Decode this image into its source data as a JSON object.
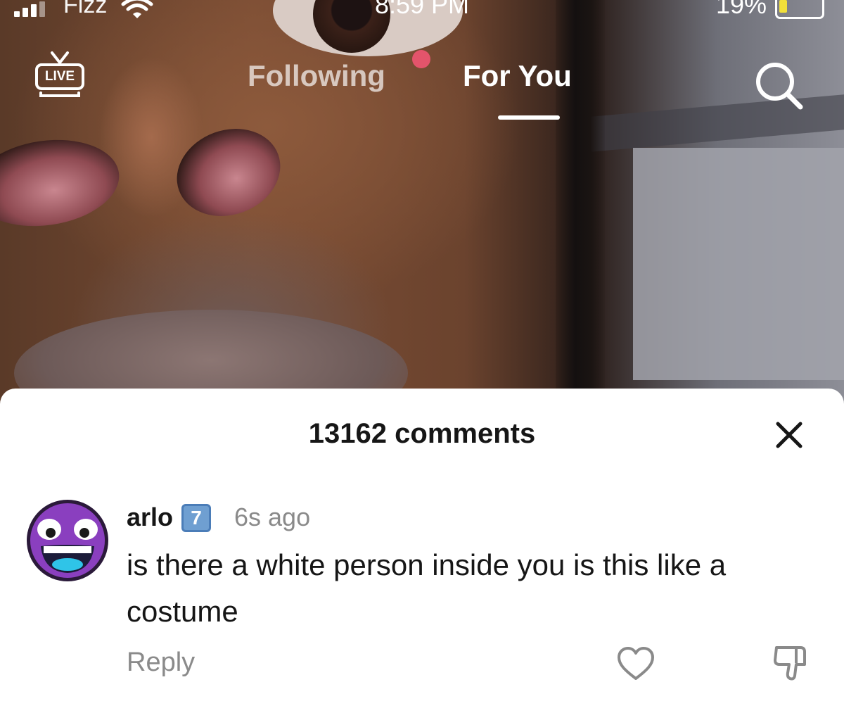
{
  "status_bar": {
    "carrier": "Fizz",
    "time": "8:59 PM",
    "battery_percent": "19%",
    "battery_level": 0.19,
    "battery_color": "#f2e03a",
    "signal_icon": "cellular-signal-icon",
    "wifi_icon": "wifi-icon"
  },
  "top_nav": {
    "live_label": "LIVE",
    "tabs": [
      {
        "label": "Following",
        "active": false
      },
      {
        "label": "For You",
        "active": true
      }
    ],
    "search_icon": "search-icon",
    "notification_dot_color": "#e3546b"
  },
  "comments": {
    "count_label": "13162 comments",
    "close_icon": "close-icon",
    "items": [
      {
        "username": "arlo",
        "badge": "7",
        "time_ago": "6s ago",
        "text": "is there a white person inside you is this like a costume",
        "reply_label": "Reply",
        "avatar_icon": "grinning-face-avatar",
        "like_icon": "heart-icon",
        "dislike_icon": "thumbs-down-icon"
      }
    ]
  }
}
